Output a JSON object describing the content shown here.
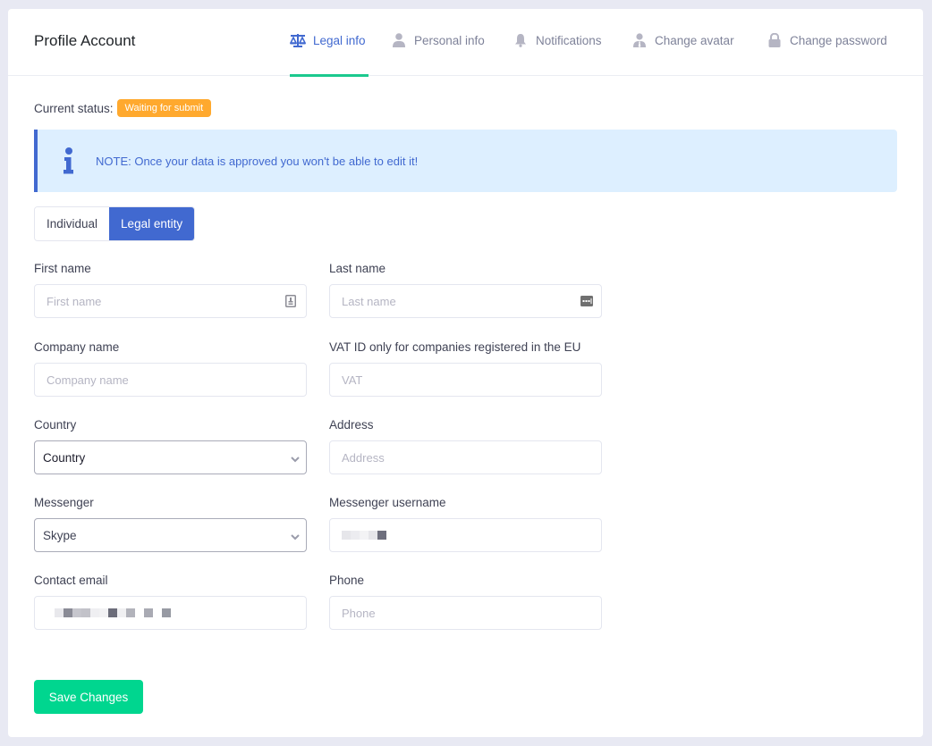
{
  "header": {
    "title": "Profile Account",
    "tabs": [
      {
        "id": "legal",
        "label": "Legal info",
        "icon": "scale-icon",
        "active": true
      },
      {
        "id": "personal",
        "label": "Personal info",
        "icon": "user-icon",
        "active": false
      },
      {
        "id": "notifications",
        "label": "Notifications",
        "icon": "bell-icon",
        "active": false
      },
      {
        "id": "avatar",
        "label": "Change avatar",
        "icon": "user-tie-icon",
        "active": false
      },
      {
        "id": "password",
        "label": "Change password",
        "icon": "lock-icon",
        "active": false
      }
    ]
  },
  "status": {
    "label": "Current status:",
    "badge": "Waiting for submit",
    "badge_color": "#ffa92e"
  },
  "note": {
    "icon": "info-icon",
    "text": "NOTE: Once your data is approved you won't be able to edit it!"
  },
  "entity_type": {
    "options": [
      "Individual",
      "Legal entity"
    ],
    "selected": "Legal entity"
  },
  "form": {
    "first_name": {
      "label": "First name",
      "placeholder": "First name",
      "value": ""
    },
    "last_name": {
      "label": "Last name",
      "placeholder": "Last name",
      "value": ""
    },
    "company_name": {
      "label": "Company name",
      "placeholder": "Company name",
      "value": ""
    },
    "vat": {
      "label": "VAT ID only for companies registered in the EU",
      "placeholder": "VAT",
      "value": ""
    },
    "country": {
      "label": "Country",
      "selected": "Country"
    },
    "address": {
      "label": "Address",
      "placeholder": "Address",
      "value": ""
    },
    "messenger": {
      "label": "Messenger",
      "selected": "Skype"
    },
    "messenger_username": {
      "label": "Messenger username",
      "value": "[redacted]"
    },
    "contact_email": {
      "label": "Contact email",
      "value": "[redacted]"
    },
    "phone": {
      "label": "Phone",
      "placeholder": "Phone",
      "value": ""
    }
  },
  "actions": {
    "save_label": "Save Changes"
  },
  "colors": {
    "accent": "#4169d0",
    "tab_underline": "#1bc98e",
    "save_button": "#00d68f",
    "note_bg": "#ddefff"
  }
}
